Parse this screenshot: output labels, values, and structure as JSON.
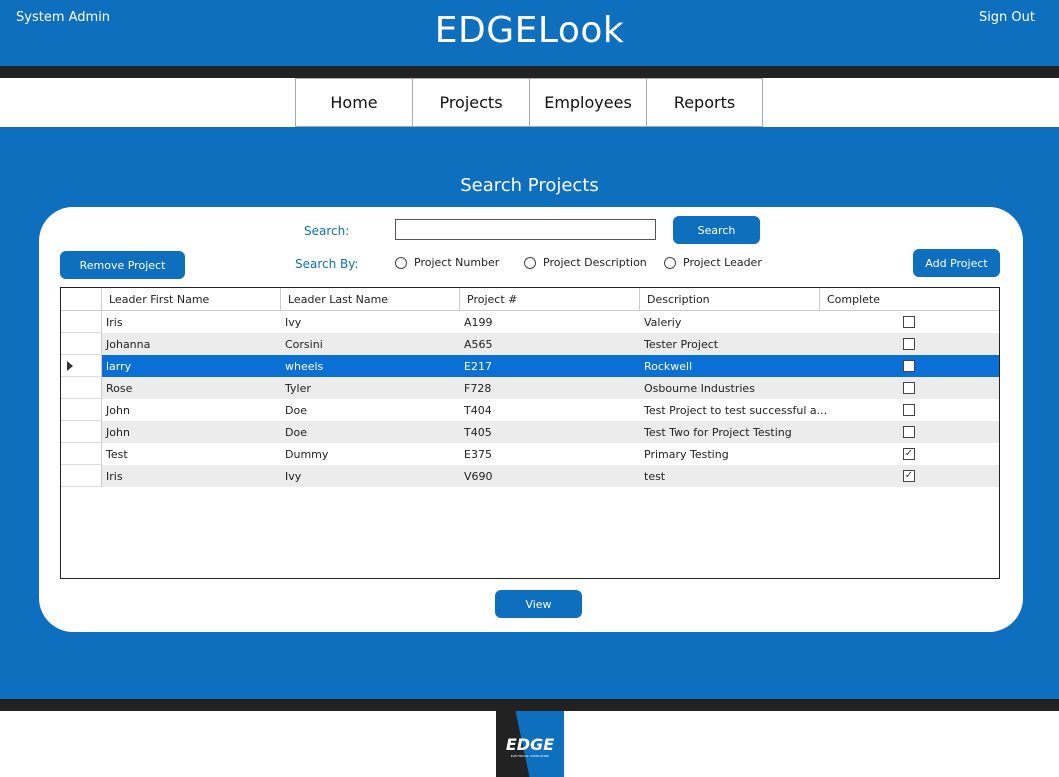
{
  "header": {
    "user": "System Admin",
    "title": "EDGELook",
    "sign_out": "Sign Out"
  },
  "nav": {
    "items": [
      {
        "label": "Home"
      },
      {
        "label": "Projects"
      },
      {
        "label": "Employees"
      },
      {
        "label": "Reports"
      }
    ]
  },
  "page": {
    "section_title": "Search Projects"
  },
  "search": {
    "label": "Search:",
    "value": "",
    "button": "Search",
    "by_label": "Search By:",
    "options": [
      {
        "label": "Project Number"
      },
      {
        "label": "Project Description"
      },
      {
        "label": "Project Leader"
      }
    ]
  },
  "actions": {
    "remove": "Remove Project",
    "add": "Add Project",
    "view": "View"
  },
  "grid": {
    "columns": [
      "Leader First Name",
      "Leader Last Name",
      "Project #",
      "Description",
      "Complete"
    ],
    "rows": [
      {
        "first": "Iris",
        "last": "Ivy",
        "num": "A199",
        "desc": "Valeriy",
        "complete": false
      },
      {
        "first": "Johanna",
        "last": "Corsini",
        "num": "A565",
        "desc": "Tester Project",
        "complete": false
      },
      {
        "first": "larry",
        "last": "wheels",
        "num": "E217",
        "desc": "Rockwell",
        "complete": false,
        "selected": true
      },
      {
        "first": "Rose",
        "last": "Tyler",
        "num": "F728",
        "desc": "Osbourne Industries",
        "complete": false
      },
      {
        "first": "John",
        "last": "Doe",
        "num": "T404",
        "desc": "Test Project to test successful a...",
        "complete": false
      },
      {
        "first": "John",
        "last": "Doe",
        "num": "T405",
        "desc": "Test Two for Project Testing",
        "complete": false
      },
      {
        "first": "Test",
        "last": "Dummy",
        "num": "E375",
        "desc": "Primary Testing",
        "complete": true
      },
      {
        "first": "Iris",
        "last": "Ivy",
        "num": "V690",
        "desc": "test",
        "complete": true
      }
    ]
  },
  "footer": {
    "logo_text": "EDGE",
    "logo_sub": "ELECTRICAL CONSULTING"
  },
  "colors": {
    "primary": "#0e6fbe",
    "dark": "#222222",
    "selected_row": "#0a70d6"
  }
}
